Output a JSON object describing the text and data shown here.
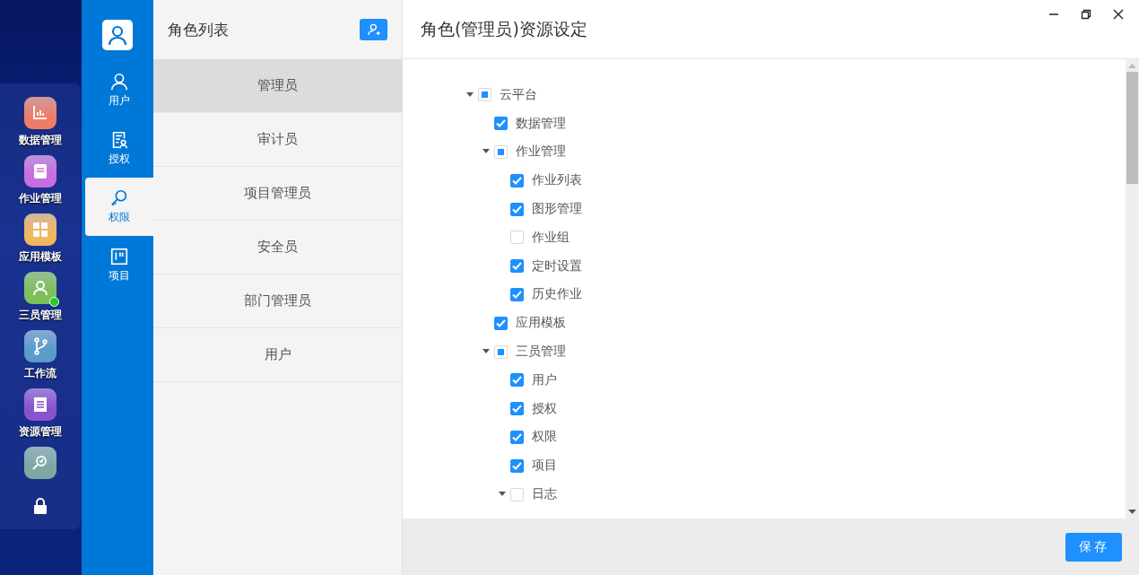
{
  "dock": {
    "items": [
      {
        "label": "数据管理",
        "color": "#f07c68",
        "badge": false
      },
      {
        "label": "作业管理",
        "color": "#c86ee0",
        "badge": false
      },
      {
        "label": "应用模板",
        "color": "#f0b660",
        "badge": false
      },
      {
        "label": "三员管理",
        "color": "#7cc05a",
        "badge": true
      },
      {
        "label": "工作流",
        "color": "#5a9ccc",
        "badge": false
      },
      {
        "label": "资源管理",
        "color": "#8a52d0",
        "badge": false
      },
      {
        "color": "#7fa8a4",
        "badge": false
      }
    ]
  },
  "nav": {
    "items": [
      {
        "label": "用户",
        "selected": false
      },
      {
        "label": "授权",
        "selected": false
      },
      {
        "label": "权限",
        "selected": true
      },
      {
        "label": "项目",
        "selected": false
      }
    ]
  },
  "roles": {
    "title": "角色列表",
    "items": [
      {
        "label": "管理员",
        "selected": true
      },
      {
        "label": "审计员",
        "selected": false
      },
      {
        "label": "项目管理员",
        "selected": false
      },
      {
        "label": "安全员",
        "selected": false
      },
      {
        "label": "部门管理员",
        "selected": false
      },
      {
        "label": "用户",
        "selected": false
      }
    ]
  },
  "panel": {
    "title": "角色(管理员)资源设定",
    "tree": [
      {
        "label": "云平台",
        "partial": true,
        "expanded": true,
        "children": [
          {
            "label": "数据管理",
            "checked": true
          },
          {
            "label": "作业管理",
            "partial": true,
            "expanded": true,
            "children": [
              {
                "label": "作业列表",
                "checked": true
              },
              {
                "label": "图形管理",
                "checked": true
              },
              {
                "label": "作业组",
                "checked": false
              },
              {
                "label": "定时设置",
                "checked": true
              },
              {
                "label": "历史作业",
                "checked": true
              }
            ]
          },
          {
            "label": "应用模板",
            "checked": true
          },
          {
            "label": "三员管理",
            "partial": true,
            "expanded": true,
            "children": [
              {
                "label": "用户",
                "checked": true
              },
              {
                "label": "授权",
                "checked": true
              },
              {
                "label": "权限",
                "checked": true
              },
              {
                "label": "项目",
                "checked": true
              },
              {
                "label": "日志",
                "checked": false,
                "expanded": true
              }
            ]
          }
        ]
      }
    ],
    "save": "保存"
  }
}
